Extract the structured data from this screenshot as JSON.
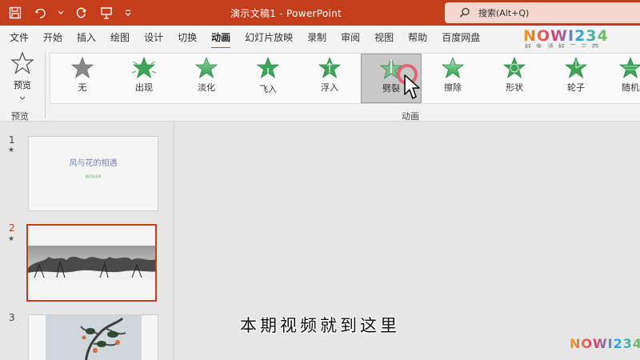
{
  "window": {
    "title": "演示文稿1  -  PowerPoint",
    "search_placeholder": "搜索(Alt+Q)"
  },
  "tabs": [
    {
      "label": "文件"
    },
    {
      "label": "开始"
    },
    {
      "label": "插入"
    },
    {
      "label": "绘图"
    },
    {
      "label": "设计"
    },
    {
      "label": "切换"
    },
    {
      "label": "动画",
      "active": true
    },
    {
      "label": "幻灯片放映"
    },
    {
      "label": "录制"
    },
    {
      "label": "审阅"
    },
    {
      "label": "视图"
    },
    {
      "label": "帮助"
    },
    {
      "label": "百度网盘"
    }
  ],
  "ribbon": {
    "preview_button": "预览",
    "preview_group": "预览",
    "animation_group": "动画",
    "animations": [
      {
        "label": "无",
        "icon": "star-none-icon"
      },
      {
        "label": "出现",
        "icon": "star-appear-icon"
      },
      {
        "label": "淡化",
        "icon": "star-fade-icon"
      },
      {
        "label": "飞入",
        "icon": "star-flyin-icon"
      },
      {
        "label": "浮入",
        "icon": "star-floatin-icon"
      },
      {
        "label": "劈裂",
        "icon": "star-split-icon",
        "selected": true
      },
      {
        "label": "擦除",
        "icon": "star-wipe-icon"
      },
      {
        "label": "形状",
        "icon": "star-shape-icon"
      },
      {
        "label": "轮子",
        "icon": "star-wheel-icon"
      },
      {
        "label": "随机线条",
        "icon": "star-randombars-icon"
      }
    ]
  },
  "slides": [
    {
      "number": "1",
      "title": "风与花的相遇",
      "subtitle": "雨打花无声"
    },
    {
      "number": "2",
      "active": true
    },
    {
      "number": "3"
    }
  ],
  "overlay": {
    "subtitle": "本期视频就到这里",
    "watermark": "NOWI234",
    "watermark_sub": "好生活好二三四"
  },
  "colors": {
    "accent": "#c43e1c",
    "star_green": "#3fa35a",
    "star_gray": "#8a8a8a"
  }
}
